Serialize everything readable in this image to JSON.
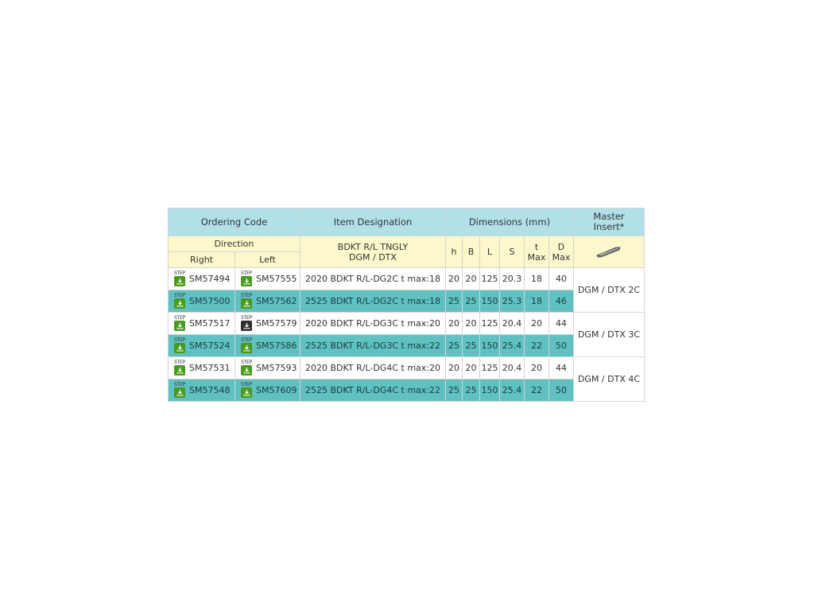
{
  "header": {
    "ordering_code": "Ordering Code",
    "item_designation": "Item Designation",
    "dimensions": "Dimensions (mm)",
    "master_insert_line1": "Master",
    "master_insert_line2": "Insert*",
    "direction": "Direction",
    "right": "Right",
    "left": "Left",
    "item_sub_line1": "BDKT R/L TNGLY",
    "item_sub_line2": "DGM / DTX",
    "dims": [
      {
        "line1": "h",
        "line2": ""
      },
      {
        "line1": "B",
        "line2": ""
      },
      {
        "line1": "L",
        "line2": ""
      },
      {
        "line1": "S",
        "line2": ""
      },
      {
        "line1": "t",
        "line2": "Max"
      },
      {
        "line1": "D",
        "line2": "Max"
      }
    ]
  },
  "step_label": "STEP",
  "rows": [
    {
      "right": "SM57494",
      "left": "SM57555",
      "designation": "2020 BDKT R/L-DG2C t max:18",
      "h": "20",
      "B": "20",
      "L": "125",
      "S": "20.3",
      "t": "18",
      "D": "40",
      "left_icon": "green"
    },
    {
      "right": "SM57500",
      "left": "SM57562",
      "designation": "2525 BDKT R/L-DG2C t max:18",
      "h": "25",
      "B": "25",
      "L": "150",
      "S": "25.3",
      "t": "18",
      "D": "46",
      "left_icon": "green"
    },
    {
      "right": "SM57517",
      "left": "SM57579",
      "designation": "2020 BDKT R/L-DG3C t max:20",
      "h": "20",
      "B": "20",
      "L": "125",
      "S": "20.4",
      "t": "20",
      "D": "44",
      "left_icon": "dark"
    },
    {
      "right": "SM57524",
      "left": "SM57586",
      "designation": "2525 BDKT R/L-DG3C t max:22",
      "h": "25",
      "B": "25",
      "L": "150",
      "S": "25.4",
      "t": "22",
      "D": "50",
      "left_icon": "green"
    },
    {
      "right": "SM57531",
      "left": "SM57593",
      "designation": "2020 BDKT R/L-DG4C t max:20",
      "h": "20",
      "B": "20",
      "L": "125",
      "S": "20.4",
      "t": "20",
      "D": "44",
      "left_icon": "green"
    },
    {
      "right": "SM57548",
      "left": "SM57609",
      "designation": "2525 BDKT R/L-DG4C t max:22",
      "h": "25",
      "B": "25",
      "L": "150",
      "S": "25.4",
      "t": "22",
      "D": "50",
      "left_icon": "green"
    }
  ],
  "master_inserts": [
    "DGM / DTX 2C",
    "DGM / DTX 3C",
    "DGM / DTX 4C"
  ],
  "colors": {
    "header_blue": "#b2e0e8",
    "header_cream": "#fcf8cc",
    "row_teal": "#5fc1c1",
    "step_green": "#4a9a1e",
    "step_dark": "#2d2d2d"
  },
  "icons": {
    "download": "download-icon",
    "insert": "master-insert-icon"
  }
}
